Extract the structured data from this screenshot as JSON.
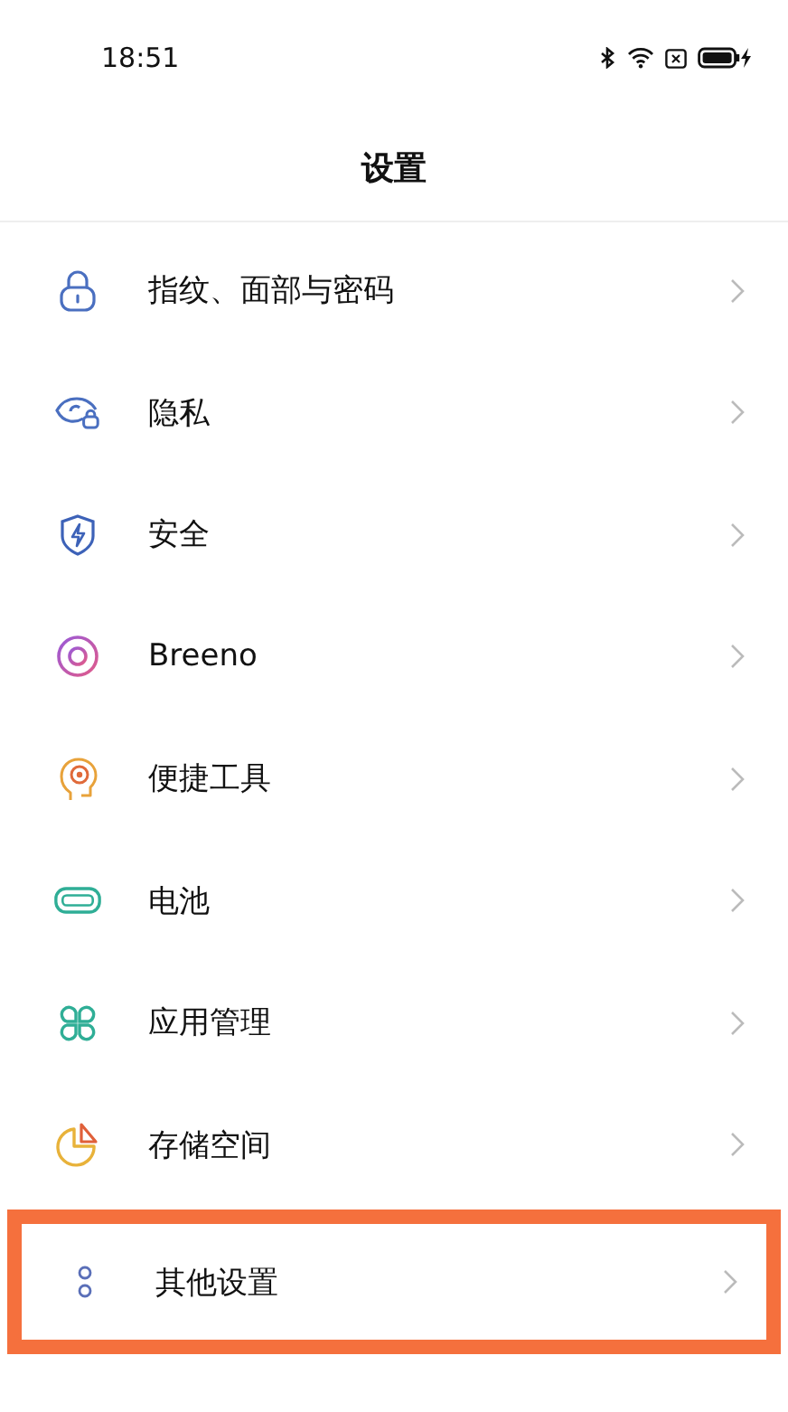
{
  "status_bar": {
    "time": "18:51"
  },
  "header": {
    "title": "设置"
  },
  "items": [
    {
      "label": "指纹、面部与密码",
      "kind": "lock",
      "highlighted": false
    },
    {
      "label": "隐私",
      "kind": "eye",
      "highlighted": false
    },
    {
      "label": "安全",
      "kind": "shield",
      "highlighted": false
    },
    {
      "label": "Breeno",
      "kind": "ring",
      "highlighted": false
    },
    {
      "label": "便捷工具",
      "kind": "head",
      "highlighted": false
    },
    {
      "label": "电池",
      "kind": "battery",
      "highlighted": false
    },
    {
      "label": "应用管理",
      "kind": "grid",
      "highlighted": false
    },
    {
      "label": "存储空间",
      "kind": "pie",
      "highlighted": false
    },
    {
      "label": "其他设置",
      "kind": "dots",
      "highlighted": true
    }
  ]
}
